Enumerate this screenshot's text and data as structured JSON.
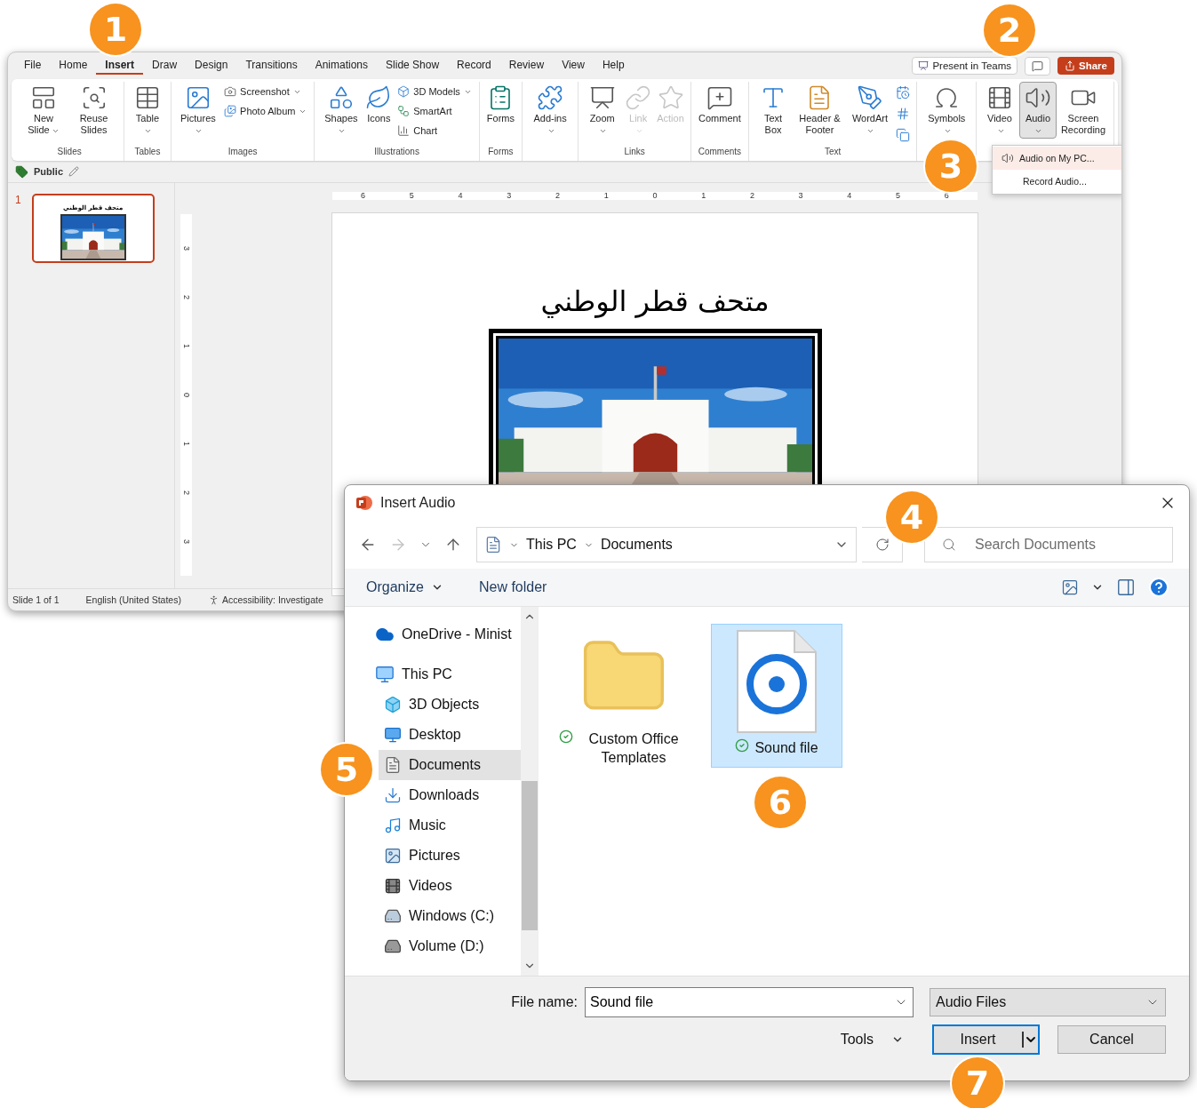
{
  "badges": [
    "1",
    "2",
    "3",
    "4",
    "5",
    "6",
    "7"
  ],
  "powerpoint": {
    "menu_tabs": [
      {
        "label": "File",
        "selected": false
      },
      {
        "label": "Home",
        "selected": false
      },
      {
        "label": "Insert",
        "selected": true
      },
      {
        "label": "Draw",
        "selected": false
      },
      {
        "label": "Design",
        "selected": false
      },
      {
        "label": "Transitions",
        "selected": false
      },
      {
        "label": "Animations",
        "selected": false
      },
      {
        "label": "Slide Show",
        "selected": false
      },
      {
        "label": "Record",
        "selected": false
      },
      {
        "label": "Review",
        "selected": false
      },
      {
        "label": "View",
        "selected": false
      },
      {
        "label": "Help",
        "selected": false
      }
    ],
    "present_button": "Present in Teams",
    "share_button": "Share",
    "ribbon_groups": [
      {
        "label": "Slides",
        "items": [
          {
            "label": "New Slide",
            "kind": "large",
            "dropdown": true,
            "disabled": false,
            "expanded": false
          },
          {
            "label": "Reuse Slides",
            "kind": "large",
            "dropdown": false,
            "disabled": false,
            "expanded": false
          }
        ]
      },
      {
        "label": "Tables",
        "items": [
          {
            "label": "Table",
            "kind": "large",
            "dropdown": true,
            "disabled": false,
            "expanded": false
          }
        ]
      },
      {
        "label": "Images",
        "items": [
          {
            "label": "Pictures",
            "kind": "large",
            "dropdown": true,
            "disabled": false,
            "expanded": false
          },
          {
            "label": "Screenshot",
            "kind": "small",
            "dropdown": true,
            "disabled": false,
            "expanded": false
          },
          {
            "label": "Photo Album",
            "kind": "small",
            "dropdown": true,
            "disabled": false,
            "expanded": false
          }
        ]
      },
      {
        "label": "Illustrations",
        "items": [
          {
            "label": "Shapes",
            "kind": "large",
            "dropdown": true,
            "disabled": false,
            "expanded": false
          },
          {
            "label": "Icons",
            "kind": "large",
            "dropdown": false,
            "disabled": false,
            "expanded": false
          },
          {
            "label": "3D Models",
            "kind": "small",
            "dropdown": true,
            "disabled": false,
            "expanded": false
          },
          {
            "label": "SmartArt",
            "kind": "small",
            "dropdown": false,
            "disabled": false,
            "expanded": false
          },
          {
            "label": "Chart",
            "kind": "small",
            "dropdown": false,
            "disabled": false,
            "expanded": false
          }
        ]
      },
      {
        "label": "Forms",
        "items": [
          {
            "label": "Forms",
            "kind": "large",
            "dropdown": false,
            "disabled": false,
            "expanded": false
          }
        ]
      },
      {
        "items": [
          {
            "label": "Add-ins",
            "kind": "large",
            "dropdown": true,
            "disabled": false,
            "expanded": false
          }
        ]
      },
      {
        "label": "Links",
        "items": [
          {
            "label": "Zoom",
            "kind": "large",
            "dropdown": true,
            "disabled": false,
            "expanded": false
          },
          {
            "label": "Link",
            "kind": "large",
            "dropdown": true,
            "disabled": true,
            "expanded": false
          },
          {
            "label": "Action",
            "kind": "large",
            "dropdown": false,
            "disabled": true,
            "expanded": false
          }
        ]
      },
      {
        "label": "Comments",
        "items": [
          {
            "label": "Comment",
            "kind": "large",
            "dropdown": false,
            "disabled": false,
            "expanded": false
          }
        ]
      },
      {
        "label": "Text",
        "items": [
          {
            "label": "Text Box",
            "kind": "large",
            "dropdown": false,
            "disabled": false,
            "expanded": false
          },
          {
            "label": "Header & Footer",
            "kind": "large",
            "dropdown": false,
            "disabled": false,
            "expanded": false
          },
          {
            "label": "WordArt",
            "kind": "large",
            "dropdown": true,
            "disabled": false,
            "expanded": false
          },
          {
            "kind": "mini",
            "dropdown": false,
            "disabled": false,
            "expanded": false
          },
          {
            "kind": "mini",
            "dropdown": false,
            "disabled": false,
            "expanded": false
          },
          {
            "kind": "mini",
            "dropdown": false,
            "disabled": false,
            "expanded": false
          }
        ]
      },
      {
        "items": [
          {
            "label": "Symbols",
            "kind": "large",
            "dropdown": true,
            "disabled": false,
            "expanded": false
          }
        ]
      },
      {
        "items": [
          {
            "label": "Video",
            "kind": "large",
            "dropdown": true,
            "disabled": false,
            "expanded": false
          },
          {
            "label": "Audio",
            "kind": "large",
            "dropdown": true,
            "disabled": false,
            "expanded": true
          },
          {
            "label": "Screen Recording",
            "kind": "large",
            "dropdown": false,
            "disabled": false,
            "expanded": false
          }
        ]
      }
    ],
    "audio_menu": [
      {
        "label": "Audio on My PC...",
        "selected": true
      },
      {
        "label": "Record Audio...",
        "selected": false
      }
    ],
    "sensitivity_label": "Public",
    "thumbnails": [
      {
        "number": "1",
        "title": "متحف قطر الوطني",
        "selected": true
      }
    ],
    "ruler_horizontal": [
      "6",
      "5",
      "4",
      "3",
      "2",
      "1",
      "0",
      "1",
      "2",
      "3",
      "4",
      "5",
      "6"
    ],
    "ruler_vertical": [
      "3",
      "2",
      "1",
      "0",
      "1",
      "2",
      "3"
    ],
    "slide_title": "متحف قطر الوطني",
    "status_bar": [
      "Slide 1 of 1",
      "English (United States)",
      "Accessibility: Investigate"
    ]
  },
  "dialog": {
    "title": "Insert Audio",
    "nav_buttons": [
      {
        "kind": "back",
        "disabled": false
      },
      {
        "kind": "forward",
        "disabled": true
      },
      {
        "kind": "recent",
        "disabled": false
      },
      {
        "kind": "up",
        "disabled": false
      }
    ],
    "breadcrumb": [
      "This PC",
      "Documents"
    ],
    "search": {
      "placeholder": "Search Documents"
    },
    "toolbar": {
      "organize": "Organize",
      "new_folder": "New folder"
    },
    "nav_tree": [
      {
        "label": "OneDrive - Minist",
        "selected": false
      },
      {
        "label": "This PC",
        "selected": false,
        "children": [
          {
            "label": "3D Objects",
            "selected": false
          },
          {
            "label": "Desktop",
            "selected": false
          },
          {
            "label": "Documents",
            "selected": true
          },
          {
            "label": "Downloads",
            "selected": false
          },
          {
            "label": "Music",
            "selected": false
          },
          {
            "label": "Pictures",
            "selected": false
          },
          {
            "label": "Videos",
            "selected": false
          },
          {
            "label": "Windows (C:)",
            "selected": false
          },
          {
            "label": "Volume (D:)",
            "selected": false
          }
        ]
      }
    ],
    "files": [
      {
        "name": "Custom Office Templates",
        "kind": "folder",
        "selected": false
      },
      {
        "name": "Sound file",
        "kind": "audio",
        "selected": true
      }
    ],
    "file_name_label": "File name:",
    "file_name": "Sound file",
    "file_type": "Audio Files",
    "tools": "Tools",
    "insert": {
      "label": "Insert",
      "focused": true
    },
    "cancel": "Cancel"
  }
}
